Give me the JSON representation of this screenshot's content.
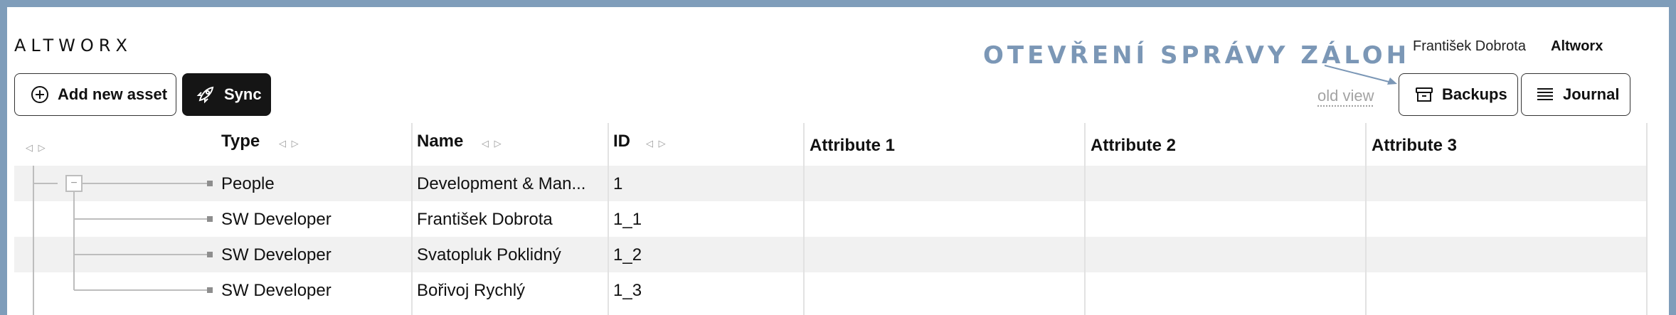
{
  "header": {
    "logo": "ALTWORX",
    "annotation": "OTEVŘENÍ SPRÁVY ZÁLOH",
    "user_name": "František Dobrota",
    "org_name": "Altworx"
  },
  "toolbar": {
    "add_label": "Add new asset",
    "sync_label": "Sync",
    "old_view_label": "old view",
    "backups_label": "Backups",
    "journal_label": "Journal"
  },
  "table": {
    "columns": [
      "Type",
      "Name",
      "ID",
      "Attribute 1",
      "Attribute 2",
      "Attribute 3"
    ],
    "rows": [
      {
        "type": "People",
        "name": "Development & Man...",
        "id": "1"
      },
      {
        "type": "SW Developer",
        "name": "František Dobrota",
        "id": "1_1"
      },
      {
        "type": "SW Developer",
        "name": "Svatopluk Poklidný",
        "id": "1_2"
      },
      {
        "type": "SW Developer",
        "name": "Bořivoj Rychlý",
        "id": "1_3"
      }
    ],
    "collapse_symbol": "−",
    "sort_symbol": "◁ ▷"
  },
  "colors": {
    "frame": "#7f9dba",
    "annotation": "#7b97b6",
    "sync_bg": "#151515",
    "row_alt": "#f1f1f1"
  }
}
